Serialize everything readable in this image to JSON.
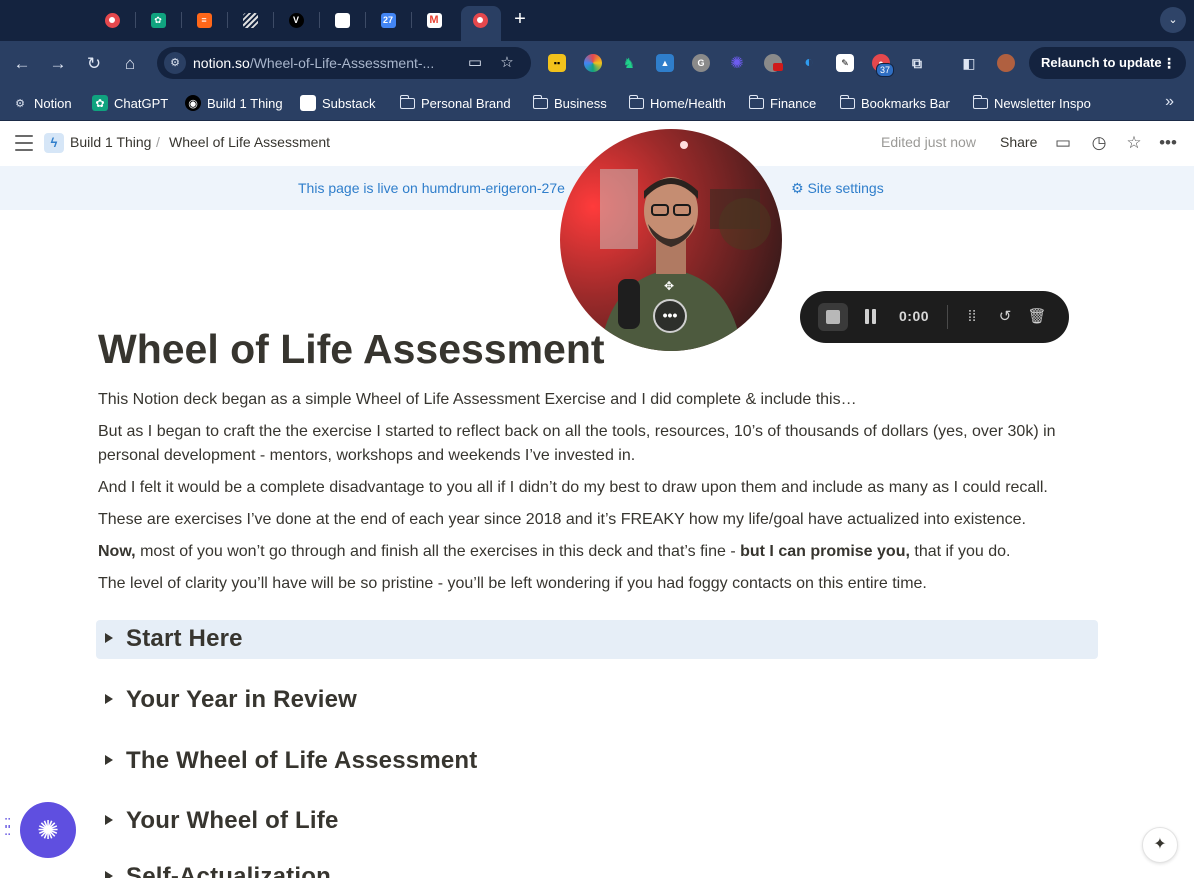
{
  "browser": {
    "tabs": [
      {
        "icon": "record-icon",
        "color": "#e5484d"
      },
      {
        "icon": "chatgpt-icon",
        "color": "#10a37f"
      },
      {
        "icon": "substack-icon",
        "color": "#ff6719"
      },
      {
        "icon": "striped-icon",
        "color": "#cccccc"
      },
      {
        "icon": "v-icon",
        "color": "#000000"
      },
      {
        "icon": "blank-page-icon",
        "color": "#ffffff"
      },
      {
        "icon": "calendar-icon",
        "color": "#4285f4",
        "text": "27"
      },
      {
        "icon": "gmail-icon",
        "color": "#ea4335"
      },
      {
        "icon": "record-icon",
        "color": "#e5484d",
        "active": true
      }
    ],
    "url_host": "notion.so",
    "url_path": "/Wheel-of-Life-Assessment-...",
    "extension_badge": "37",
    "relaunch_label": "Relaunch to update"
  },
  "bookmarks": [
    {
      "label": "Notion",
      "icon": "gear-icon"
    },
    {
      "label": "ChatGPT",
      "icon": "chatgpt-icon"
    },
    {
      "label": "Build 1 Thing",
      "icon": "circle-icon"
    },
    {
      "label": "Substack",
      "icon": "page-icon"
    },
    {
      "label": "Personal Brand",
      "icon": "folder-icon"
    },
    {
      "label": "Business",
      "icon": "folder-icon"
    },
    {
      "label": "Home/Health",
      "icon": "folder-icon"
    },
    {
      "label": "Finance",
      "icon": "folder-icon"
    },
    {
      "label": "Bookmarks Bar",
      "icon": "folder-icon"
    },
    {
      "label": "Newsletter Inspo",
      "icon": "folder-icon"
    }
  ],
  "notion": {
    "breadcrumb": [
      "Build 1 Thing",
      "/",
      "Wheel of Life Assessment"
    ],
    "edited": "Edited just now",
    "share": "Share",
    "banner": "This page is live on humdrum-erigeron-27e",
    "site_settings": "Site settings"
  },
  "page": {
    "title": "Wheel of Life Assessment",
    "paragraphs": [
      "This Notion deck began as a simple Wheel of Life Assessment Exercise and I did complete & include this…",
      "But as I began to craft the the exercise I started to reflect back on all the tools, resources, 10’s of thousands of dollars (yes, over 30k) in personal development - mentors, workshops and weekends I’ve invested in.",
      "And I felt it would be a complete disadvantage to you all if I didn’t do my best to draw upon them and include as many as I could recall.",
      "These are exercises I’ve done at the end of each year since 2018 and it’s FREAKY how my life/goal have actualized into existence."
    ],
    "p5": {
      "bold1": "Now,",
      "text1": " most of you won’t go through and finish all the exercises in this deck and that’s fine - ",
      "bold2": "but I can promise you,",
      "text2": " that if you do."
    },
    "p6": "The level of clarity you’ll have will be so pristine - you’ll be left wondering if you had foggy contacts on this entire time.",
    "toggles": [
      "Start Here",
      "Your Year in Review",
      "The Wheel of Life Assessment",
      "Your Wheel of Life",
      "Self-Actualization"
    ]
  },
  "recorder": {
    "time": "0:00"
  },
  "colors": {
    "accent": "#2f7ecb",
    "fab": "#5f4fe0",
    "chrome_dark": "#14233f",
    "chrome": "#2a3f63"
  }
}
